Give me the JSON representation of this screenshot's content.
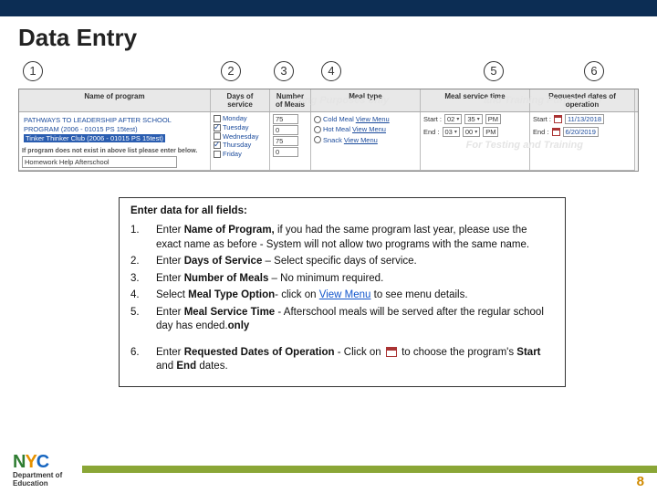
{
  "title": "Data Entry",
  "circles": [
    "1",
    "2",
    "3",
    "4",
    "5",
    "6"
  ],
  "table": {
    "headers": {
      "program": "Name of program",
      "days": "Days of service",
      "meals": "Number of Meals",
      "mealtype": "Meal type",
      "time": "Meal service time",
      "dates": "Requested dates of operation"
    },
    "programs": {
      "row1": "PATHWAYS TO LEADERSHIP AFTER SCHOOL PROGRAM (2006 - 01015 PS 15test)",
      "row2_selected": "Tinker Thinker Club (2006 - 01015 PS 15test)",
      "hint": "If program does not exist in above list please enter below.",
      "input_value": "Homework Help Afterschool"
    },
    "days": {
      "mon": "Monday",
      "tue": "Tuesday",
      "wed": "Wednesday",
      "thu": "Thursday",
      "fri": "Friday"
    },
    "meals": {
      "r1": "75",
      "r2": "0",
      "r3": "75",
      "r4": "0"
    },
    "mealtypes": {
      "cold": "Cold Meal",
      "hot": "Hot Meal",
      "snack": "Snack",
      "view": "View Menu"
    },
    "time": {
      "start_label": "Start :",
      "end_label": "End :",
      "start_h": "02",
      "start_m": "35",
      "ampm": "PM",
      "end_h": "03",
      "end_m": "00"
    },
    "dates": {
      "start_label": "Start :",
      "end_label": "End :",
      "start": "11/13/2018",
      "end": "6/20/2019"
    }
  },
  "instructions": {
    "heading": "Enter data for all fields:",
    "items": [
      {
        "n": "1.",
        "pre": "Enter ",
        "bold": "Name of Program,",
        "rest": " if you had the same program last year, please use the exact name as before - System will not allow two programs with the same name."
      },
      {
        "n": "2.",
        "pre": "Enter ",
        "bold": "Days of Service",
        "rest": " – Select specific days of service."
      },
      {
        "n": "3.",
        "pre": "Enter ",
        "bold": "Number of Meals",
        "rest": " – No minimum required."
      },
      {
        "n": "4.",
        "pre": "Select ",
        "bold": "Meal Type Option",
        "rest": "- click on ",
        "link": "View Menu",
        "rest2": " to see menu details."
      },
      {
        "n": "5.",
        "pre": "Enter ",
        "bold": "Meal Service Time",
        "rest": " - Afterschool meals will be served ",
        "bold2": "only",
        "rest2": " after the regular school day has ended."
      },
      {
        "n": "6.",
        "pre": "Enter ",
        "bold": "Requested Dates of Operation",
        "rest": " - Click on ",
        "cal": true,
        "rest2": " to choose the program's ",
        "bold2": "Start",
        "rest3": " and ",
        "bold3": "End",
        "rest4": " dates."
      }
    ]
  },
  "footer": {
    "dept1": "Department of",
    "dept2": "Education",
    "pagenum": "8"
  }
}
